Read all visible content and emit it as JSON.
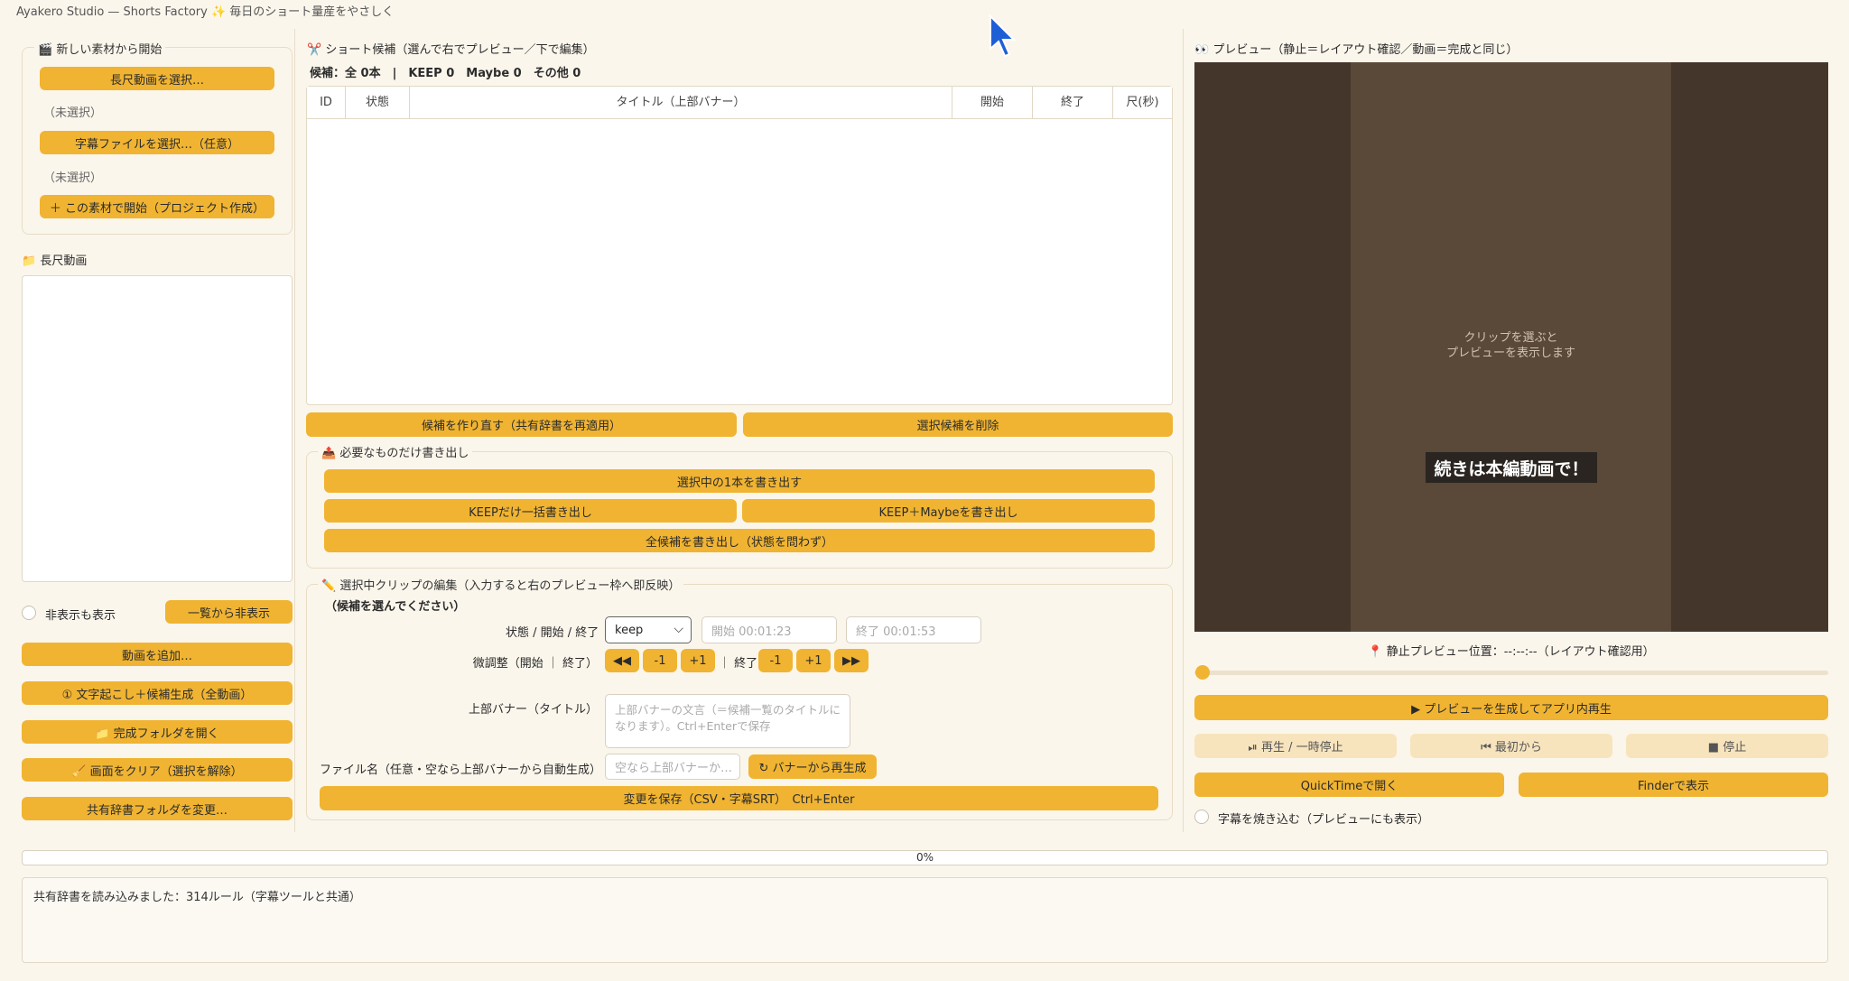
{
  "window": {
    "title": "Ayakero Studio — Shorts Factory ✨ 毎日のショート量産をやさしく",
    "title_icon": "scissors-icon"
  },
  "left": {
    "new_source": {
      "label": "🎬 新しい素材から開始",
      "pick_video": "長尺動画を選択…",
      "video_status": "（未選択）",
      "pick_subtitle": "字幕ファイルを選択…（任意）",
      "subtitle_status": "（未選択）",
      "start_project": "＋ この素材で開始（プロジェクト作成）"
    },
    "video_list_label": "📁 長尺動画",
    "show_hidden": "非表示も表示",
    "hide_from_list": "一覧から非表示",
    "add_video": "動画を追加…",
    "transcribe": "① 文字起こし＋候補生成（全動画）",
    "open_folder": "📁 完成フォルダを開く",
    "clear_screen": "🧹 画面をクリア（選択を解除）",
    "change_dict": "共有辞書フォルダを変更…"
  },
  "middle": {
    "candidates_label": "✂️ ショート候補（選んで右でプレビュー／下で編集）",
    "summary": "候補：全 0本　|　KEEP 0　Maybe 0　その他 0",
    "columns": [
      "ID",
      "状態",
      "タイトル（上部バナー）",
      "開始",
      "終了",
      "尺(秒)"
    ],
    "rebuild": "候補を作り直す（共有辞書を再適用）",
    "delete_selected": "選択候補を削除",
    "export": {
      "label": "📤 必要なものだけ書き出し",
      "export_one": "選択中の1本を書き出す",
      "export_keep": "KEEPだけ一括書き出し",
      "export_keep_maybe": "KEEP＋Maybeを書き出し",
      "export_all": "全候補を書き出し（状態を問わず）"
    },
    "edit": {
      "label": "✏️ 選択中クリップの編集（入力すると右のプレビュー枠へ即反映）",
      "hint": "（候補を選んでください）",
      "status_label": "状態 / 開始 / 終了",
      "status_value": "keep",
      "start_placeholder": "開始 00:01:23",
      "end_placeholder": "終了 00:01:53",
      "fine_label": "微調整（開始 ｜ 終了）",
      "jump_back": "◀◀",
      "minus1": "-1",
      "plus1": "+1",
      "end_text": "｜ 終了",
      "minus1b": "-1",
      "plus1b": "+1",
      "jump_fwd": "▶▶",
      "banner_label": "上部バナー（タイトル）",
      "banner_placeholder": "上部バナーの文言（＝候補一覧のタイトルになります）。Ctrl+Enterで保存",
      "filename_label": "ファイル名（任意・空なら上部バナーから自動生成）",
      "filename_placeholder": "空なら上部バナーか…",
      "regen": "↻ バナーから再生成",
      "save": "変更を保存（CSV・字幕SRT）　Ctrl+Enter"
    }
  },
  "right": {
    "preview_label": "👀 プレビュー（静止＝レイアウト確認／動画＝完成と同じ）",
    "placeholder_line1": "クリップを選ぶと",
    "placeholder_line2": "プレビューを表示します",
    "caption": "続きは本編動画で！",
    "position": "📍 静止プレビュー位置：--:--:--（レイアウト確認用）",
    "slider_value": 0,
    "generate": "▶ プレビューを生成してアプリ内再生",
    "play_pause": "⏯ 再生 / 一時停止",
    "from_start": "⏮ 最初から",
    "stop": "■ 停止",
    "quicktime": "QuickTimeで開く",
    "finder": "Finderで表示",
    "burn_subs": "字幕を焼き込む（プレビューにも表示）"
  },
  "progress": {
    "percent": "0%",
    "value": 0
  },
  "log": {
    "text": "共有辞書を読み込みました：314ルール（字幕ツールと共通）"
  },
  "colors": {
    "accent": "#f0b432",
    "background": "#fbf6ec",
    "preview_outer": "#45362b",
    "preview_inner": "#5a4838"
  }
}
